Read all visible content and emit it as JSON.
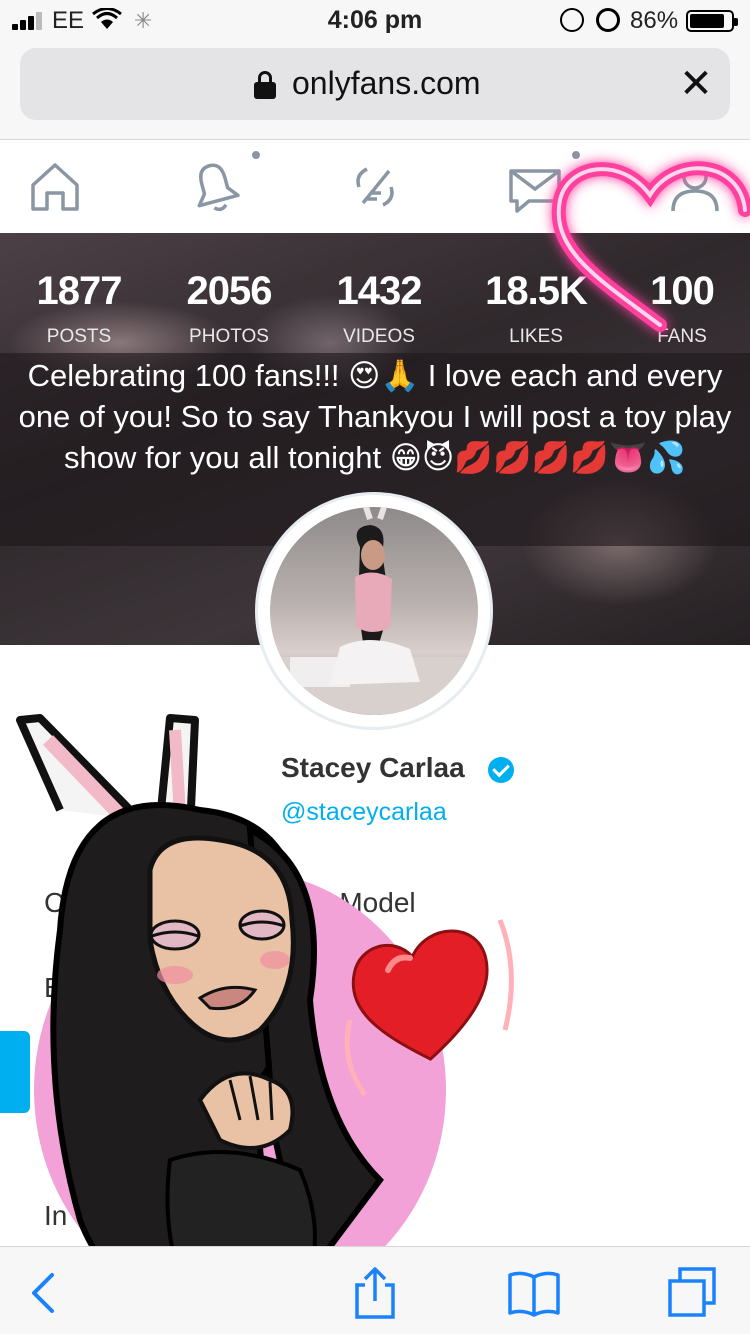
{
  "status_bar": {
    "carrier": "EE",
    "time": "4:06 pm",
    "battery_percent": "86%",
    "battery_level": 0.86,
    "icons": [
      "signal-icon",
      "wifi-icon",
      "activity-spinner-icon",
      "orientation-lock-icon",
      "alarm-icon",
      "battery-icon"
    ]
  },
  "browser": {
    "url": "onlyfans.com",
    "close_glyph": "✕",
    "toolbar_icons": [
      "back-icon",
      "share-icon",
      "bookmarks-icon",
      "tabs-icon"
    ]
  },
  "app_nav": {
    "items": [
      "home-icon",
      "bell-icon",
      "compose-icon",
      "messages-icon",
      "profile-icon"
    ]
  },
  "stats": [
    {
      "value": "1877",
      "label": "POSTS"
    },
    {
      "value": "2056",
      "label": "PHOTOS"
    },
    {
      "value": "1432",
      "label": "VIDEOS"
    },
    {
      "value": "18.5K",
      "label": "LIKES"
    },
    {
      "value": "100",
      "label": "FANS"
    }
  ],
  "caption": "Celebrating 100 fans!!! 😍🙏 I love each and every one of you! So to say Thankyou I will post a toy play show for you all tonight 😁😈💋💋💋💋👅💦",
  "profile": {
    "name": "Stacey Carlaa",
    "handle": "@staceycarlaa",
    "bio_visible": "n Model",
    "fragments": [
      "C",
      "Bi",
      "In"
    ]
  },
  "colors": {
    "accent": "#00aff0",
    "neon_heart": "#ff3f9f",
    "sticker_background": "#f2a2d6",
    "heart": "#e41e26"
  }
}
